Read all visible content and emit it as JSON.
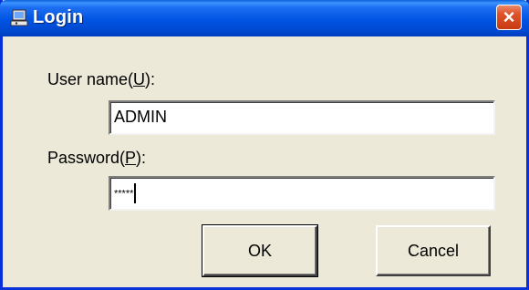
{
  "window": {
    "title": "Login",
    "close_label": "×"
  },
  "username": {
    "label_prefix": "User name(",
    "accel": "U",
    "label_suffix": "):",
    "value": "ADMIN"
  },
  "password": {
    "label_prefix": "Password(",
    "accel": "P",
    "label_suffix": "):",
    "masked_value": "*****"
  },
  "buttons": {
    "ok": "OK",
    "cancel": "Cancel"
  },
  "colors": {
    "titlebar": "#0054e3",
    "close": "#e0522a",
    "dialog_bg": "#ece9d8"
  },
  "icons": {
    "title_icon": "computer-user-icon"
  }
}
